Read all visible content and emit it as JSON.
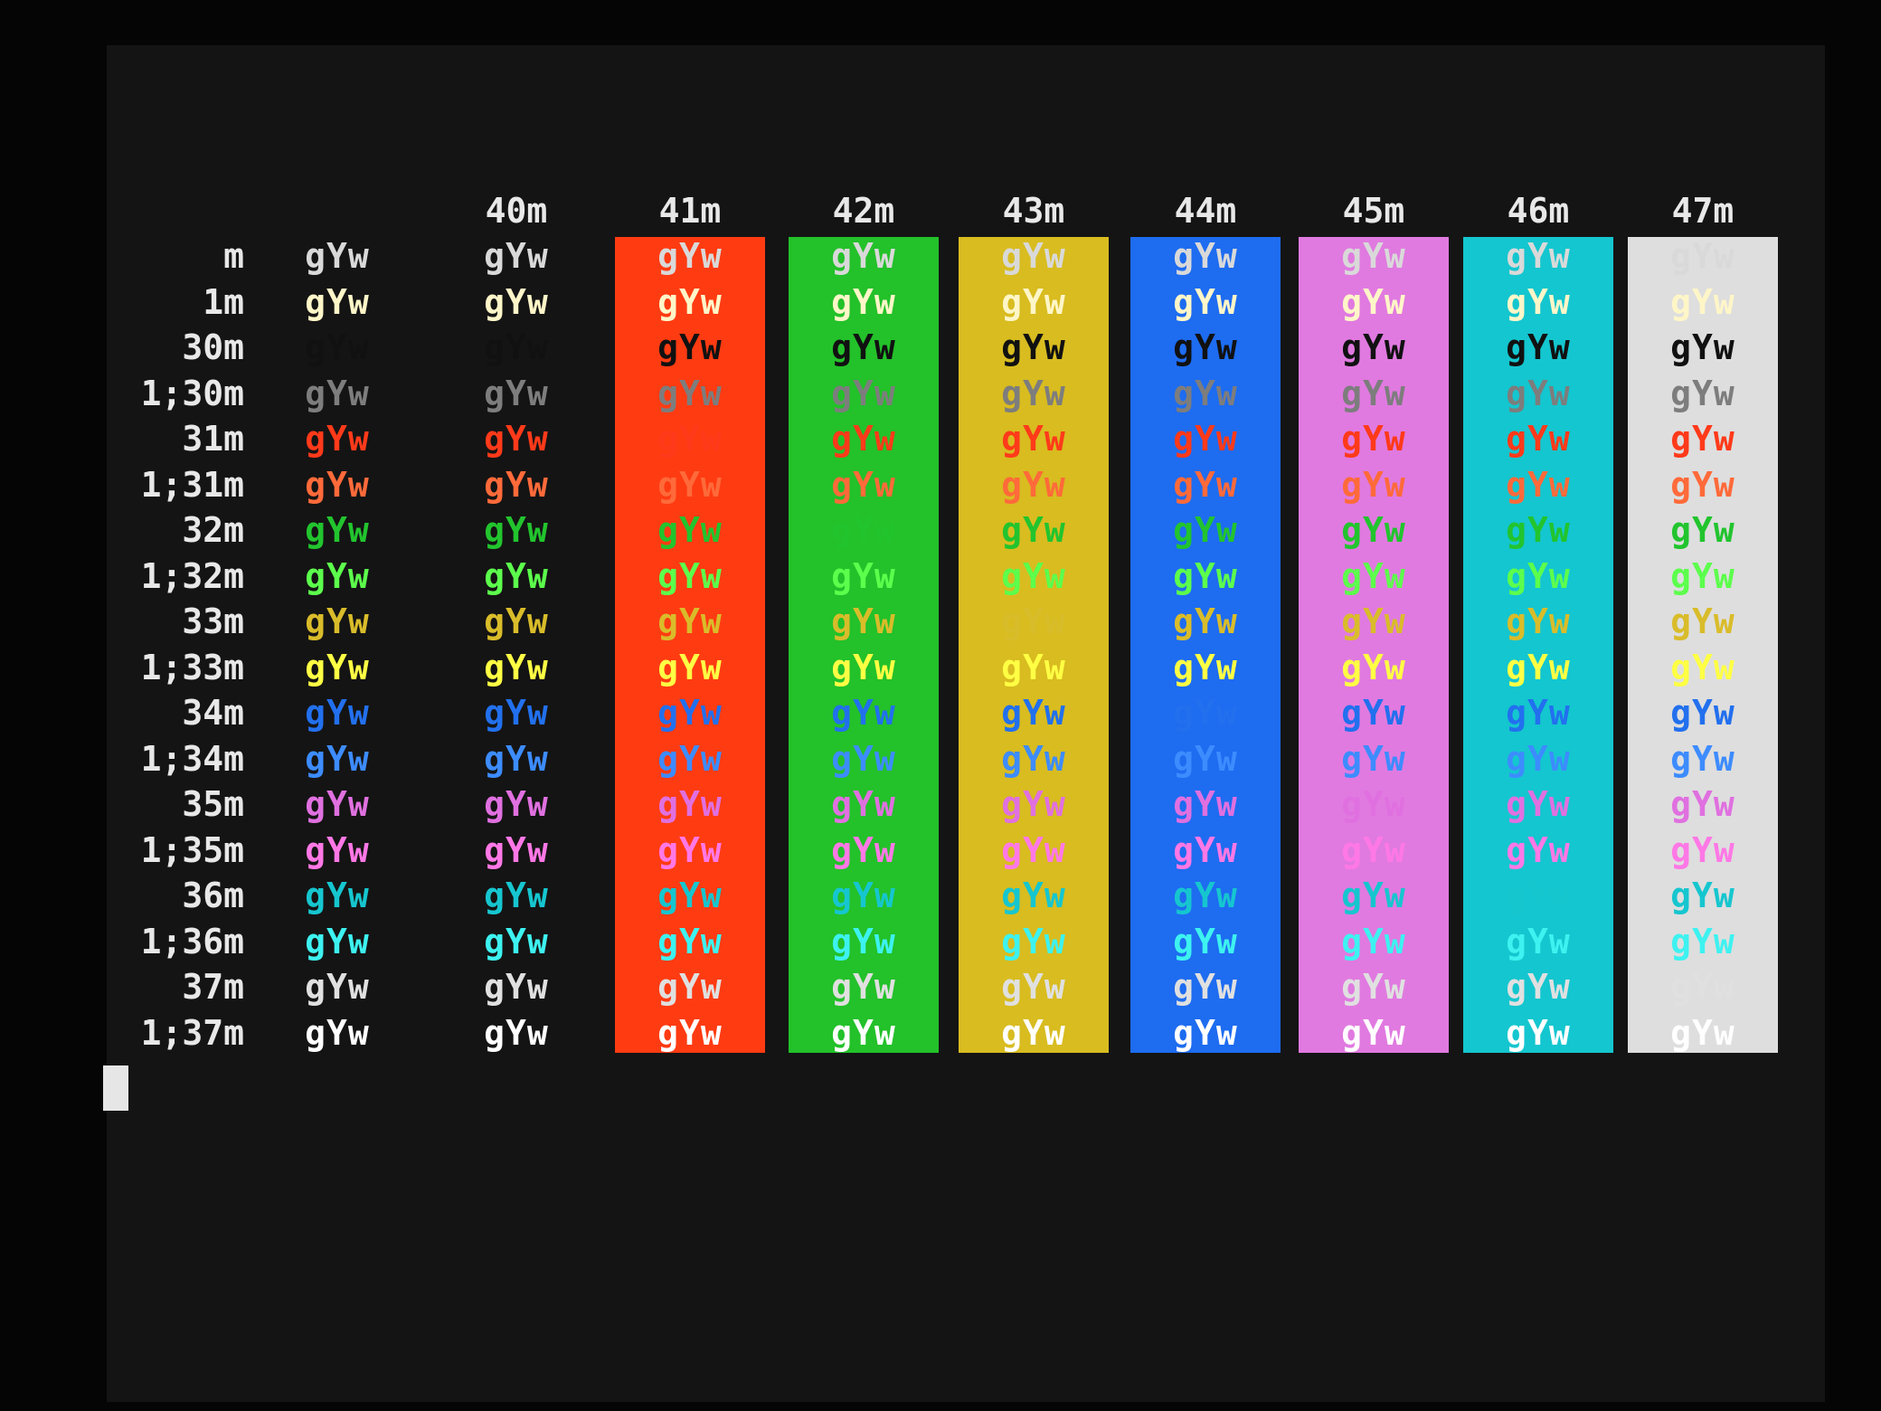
{
  "sample": "gYw",
  "columns": [
    {
      "label": "",
      "bg": null
    },
    {
      "label": "40m",
      "bg": null
    },
    {
      "label": "41m",
      "bg": "#ff3b12"
    },
    {
      "label": "42m",
      "bg": "#23c12a"
    },
    {
      "label": "43m",
      "bg": "#d8bc20"
    },
    {
      "label": "44m",
      "bg": "#1e6cf0"
    },
    {
      "label": "45m",
      "bg": "#e07ae0"
    },
    {
      "label": "46m",
      "bg": "#14c6cf"
    },
    {
      "label": "47m",
      "bg": "#dedede"
    }
  ],
  "rows": [
    {
      "label": "m",
      "color": "#d9d9d9"
    },
    {
      "label": "1m",
      "color": "#fff6c8"
    },
    {
      "label": "30m",
      "color": "#111111"
    },
    {
      "label": "1;30m",
      "color": "#7d7d7d"
    },
    {
      "label": "31m",
      "color": "#ff3a1a"
    },
    {
      "label": "1;31m",
      "color": "#ff6a3a"
    },
    {
      "label": "32m",
      "color": "#22c42e"
    },
    {
      "label": "1;32m",
      "color": "#5cff4c"
    },
    {
      "label": "33m",
      "color": "#d9bc2a"
    },
    {
      "label": "1;33m",
      "color": "#ffff44"
    },
    {
      "label": "34m",
      "color": "#2270ee"
    },
    {
      "label": "1;34m",
      "color": "#3d8cff"
    },
    {
      "label": "35m",
      "color": "#e070e0"
    },
    {
      "label": "1;35m",
      "color": "#ff78e6"
    },
    {
      "label": "36m",
      "color": "#16c6cf"
    },
    {
      "label": "1;36m",
      "color": "#3df2f0"
    },
    {
      "label": "37m",
      "color": "#e0e0e0"
    },
    {
      "label": "1;37m",
      "color": "#ffffff"
    }
  ]
}
